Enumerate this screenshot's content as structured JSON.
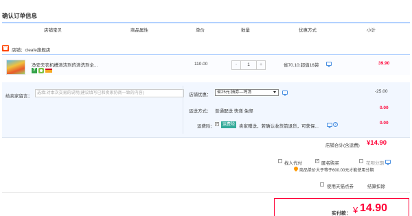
{
  "page": {
    "title": "确认订单信息"
  },
  "table_headers": {
    "shop_item": "店铺宝贝",
    "attributes": "商品属性",
    "unit_price": "单价",
    "quantity": "数量",
    "discount": "优惠方式",
    "subtotal": "小计"
  },
  "shop": {
    "label": "店铺：cleafe旗舰店"
  },
  "item": {
    "title": "净安夫衣机槽清洁剂的清洗剂全...",
    "price": "110.00",
    "quantity": "1",
    "qty_minus": "-",
    "qty_plus": "+",
    "discount_text": "省70.10:超值16袋",
    "subtotal": "39.90",
    "badge_seven": "7"
  },
  "options": {
    "message_label": "给卖家留言：",
    "message_placeholder": "选填:对本次交易的说明(建议填写已和卖家协商一致的内容)",
    "shop_discount_label": "店铺优惠：",
    "shop_discount_selected": "省25元:抽券—鸡汤",
    "shop_discount_value": "-25.00",
    "shipping_label": "运送方式：",
    "shipping_text": "普通配送 快递 免邮",
    "shipping_value": "0.00",
    "insurance_label": "运费险：",
    "insurance_tag": "运费险",
    "insurance_text": "卖家赠送，若确认收货前退货，可获保...",
    "insurance_value": "0.00",
    "help_glyph": "?"
  },
  "shop_total": {
    "label": "店铺合计(含运费)",
    "value": "¥14.90"
  },
  "checkboxes": {
    "proxy_pay": "找人代付",
    "anonymous": "匿名购买",
    "installment": "花呗分期",
    "tmall_points": "使用天猫点券"
  },
  "hint": "商品单价大于等于600.00元才能使用分期",
  "settle": "结算扣除",
  "payment": {
    "label": "实付款：",
    "currency": "¥",
    "value": "14.90"
  },
  "colors": {
    "accent_red": "#ff0036",
    "header_line": "#b2d1ff",
    "panel_blue": "#f2f7ff"
  }
}
